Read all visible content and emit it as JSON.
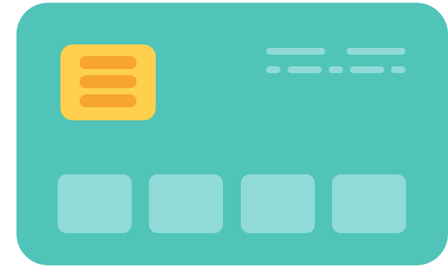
{
  "colors": {
    "background": "#ffffff",
    "card": "#50c4b8",
    "chip": "#fed04e",
    "chip_stripe": "#f7a52c",
    "card_line": "#90dbd7",
    "tile": "#90dbd7"
  },
  "icons": {
    "card": "credit-card-icon",
    "chip": "card-chip-icon"
  }
}
